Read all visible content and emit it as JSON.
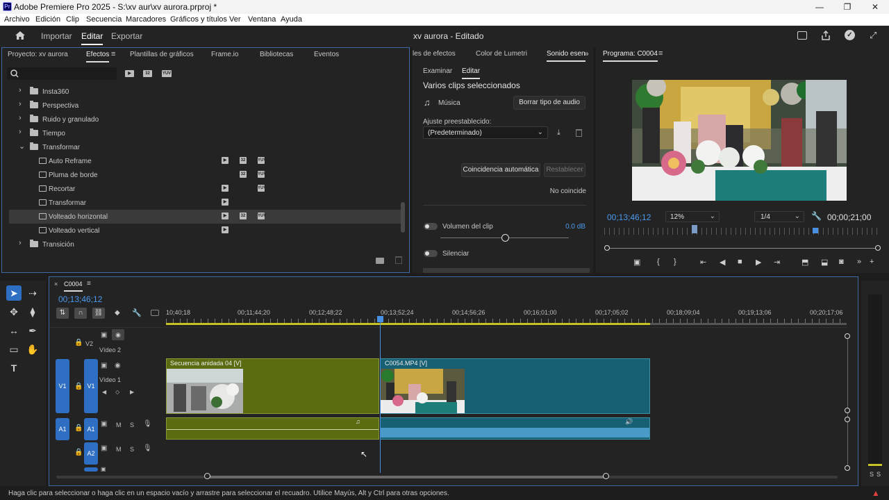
{
  "window": {
    "title": "Adobe Premiere Pro 2025 - S:\\xv aur\\xv aurora.prproj *",
    "app_icon": "Pr"
  },
  "menu": [
    "Archivo",
    "Edición",
    "Clip",
    "Secuencia",
    "Marcadores",
    "Gráficos y títulos",
    "Ver",
    "Ventana",
    "Ayuda"
  ],
  "header": {
    "nav": [
      "Importar",
      "Editar",
      "Exportar"
    ],
    "active": "Editar",
    "title": "xv aurora - Editado"
  },
  "project_panel": {
    "tabs": [
      "Proyecto: xv aurora",
      "Efectos",
      "Plantillas de gráficos",
      "Frame.io",
      "Bibliotecas",
      "Eventos"
    ],
    "active_tab": "Efectos",
    "tree": [
      {
        "label": "Insta360",
        "type": "folder",
        "expanded": false
      },
      {
        "label": "Perspectiva",
        "type": "folder",
        "expanded": false
      },
      {
        "label": "Ruido y granulado",
        "type": "folder",
        "expanded": false
      },
      {
        "label": "Tiempo",
        "type": "folder",
        "expanded": false
      },
      {
        "label": "Transformar",
        "type": "folder",
        "expanded": true
      },
      {
        "label": "Auto Reframe",
        "type": "effect",
        "badges": [
          "32",
          "32",
          "YUV"
        ]
      },
      {
        "label": "Pluma de borde",
        "type": "effect",
        "badges": [
          "",
          "32",
          "YUV"
        ]
      },
      {
        "label": "Recortar",
        "type": "effect",
        "badges": [
          "32",
          "",
          "YUV"
        ]
      },
      {
        "label": "Transformar",
        "type": "effect",
        "badges": [
          "32",
          "",
          ""
        ]
      },
      {
        "label": "Volteado horizontal",
        "type": "effect",
        "badges": [
          "32",
          "32",
          "YUV"
        ],
        "selected": true
      },
      {
        "label": "Volteado vertical",
        "type": "effect",
        "badges": [
          "32",
          "",
          ""
        ]
      },
      {
        "label": "Transición",
        "type": "folder",
        "expanded": false
      }
    ]
  },
  "audio_panel": {
    "tabs": [
      "les de efectos",
      "Color de Lumetri",
      "Sonido esen"
    ],
    "subtabs": [
      "Examinar",
      "Editar"
    ],
    "heading": "Varios clips seleccionados",
    "type_label": "Música",
    "clear_button": "Borrar tipo de audio",
    "preset_label": "Ajuste preestablecido:",
    "preset_value": "(Predeterminado)",
    "auto_match": "Coincidencia automática",
    "reset": "Restablecer",
    "no_match": "No coincide",
    "clip_volume": "Volumen del clip",
    "clip_volume_value": "0.0 dB",
    "volume_level": 0.5,
    "mute": "Silenciar"
  },
  "program_monitor": {
    "title": "Programa: C0004",
    "timecode": "00;13;46;12",
    "zoom": "12%",
    "resolution": "1/4",
    "duration": "00;00;21;00"
  },
  "timeline": {
    "sequence": "C0004",
    "timecode": "00;13;46;12",
    "ruler": [
      "10;40;18",
      "00;11;44;20",
      "00;12;48;22",
      "00;13;52;24",
      "00;14;56;26",
      "00;16;01;00",
      "00;17;05;02",
      "00;18;09;04",
      "00;19;13;06",
      "00;20;17;06"
    ],
    "tracks": {
      "v2": {
        "id": "V2",
        "name": "Vídeo 2"
      },
      "v1": {
        "id": "V1",
        "name": "Vídeo 1",
        "source": "V1"
      },
      "a1": {
        "id": "A1",
        "source": "A1"
      },
      "a2": {
        "id": "A2"
      }
    },
    "clips": {
      "nested": "Secuencia anidada 04 [V]",
      "video": "C0054.MP4 [V]"
    },
    "m": "M",
    "s": "S"
  },
  "meter": {
    "s1": "S",
    "s2": "S"
  },
  "status_bar": "Haga clic para seleccionar o haga clic en un espacio vacío y arrastre para seleccionar el recuadro. Utilice Mayús, Alt y Ctrl para otras opciones.",
  "colors": {
    "nested_clip": "#5a6b12",
    "video_clip": "#175f73",
    "audio_clip": "#4a9ac8",
    "accent": "#2e6fc4",
    "playhead": "#4a90e2"
  }
}
